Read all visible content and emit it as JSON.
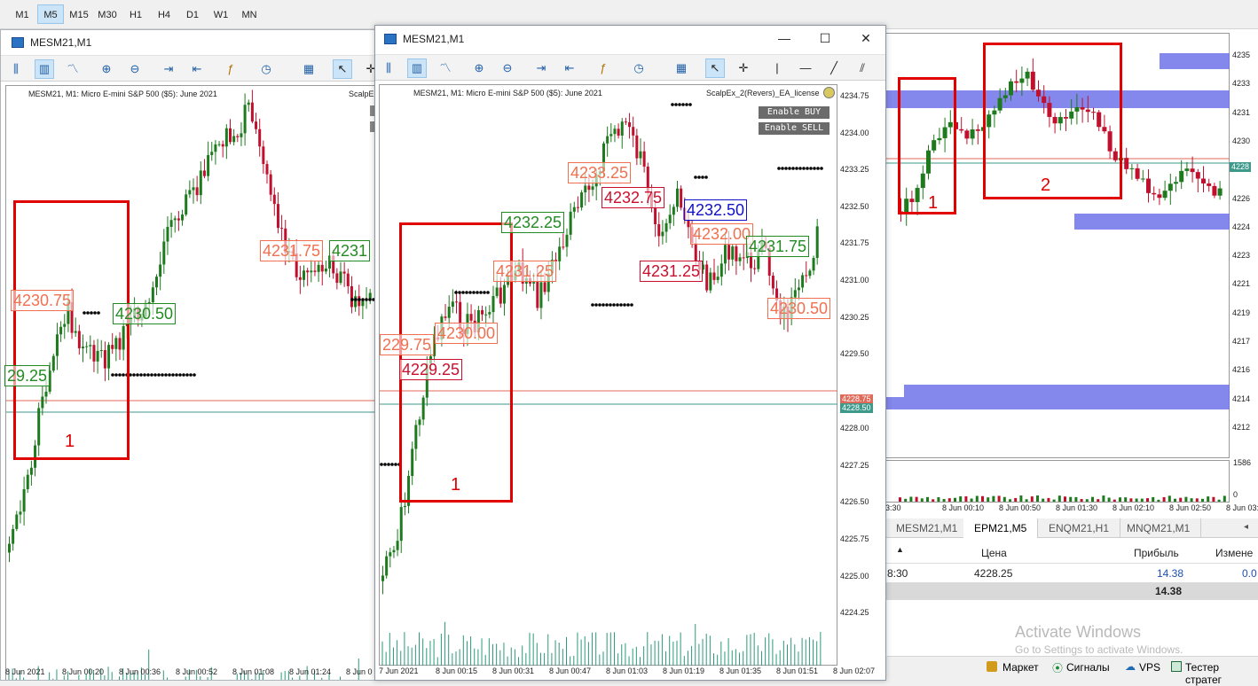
{
  "timeframes": [
    "M1",
    "M5",
    "M15",
    "M30",
    "H1",
    "H4",
    "D1",
    "W1",
    "MN"
  ],
  "timeframe_active": "M5",
  "left_window": {
    "title": "MESM21,M1",
    "chart_info": "MESM21, M1:  Micro E-mini S&P 500 ($5): June 2021",
    "ea_label": "ScalpE",
    "box_label": "1",
    "levels": [
      {
        "text": "4230.75",
        "color": "#f07050"
      },
      {
        "text": "4230.50",
        "color": "#228b22"
      },
      {
        "text": "29.25",
        "color": "#228b22"
      },
      {
        "text": "4231.75",
        "color": "#f07050"
      },
      {
        "text": "4231",
        "color": "#228b22"
      }
    ],
    "time_ticks": [
      "8 Jun 2021",
      "8 Jun 00:20",
      "8 Jun 00:36",
      "8 Jun 00:52",
      "8 Jun 01:08",
      "8 Jun 01:24",
      "8 Jun 0"
    ]
  },
  "middle_window": {
    "title": "MESM21,M1",
    "minimize_glyph": "—",
    "maximize_glyph": "☐",
    "close_glyph": "✕",
    "chart_info": "MESM21, M1:  Micro E-mini S&P 500 ($5): June 2021",
    "ea_label": "ScalpEx_2(Revers)_EA_license",
    "enable_buy": "Enable BUY",
    "enable_sell": "Enable SELL",
    "box_label": "1",
    "levels": [
      {
        "text": "4233.25",
        "color": "#f07050"
      },
      {
        "text": "4232.75",
        "color": "#c8102e"
      },
      {
        "text": "4232.25",
        "color": "#228b22"
      },
      {
        "text": "4232.50",
        "color": "#1010c8"
      },
      {
        "text": "4232.00",
        "color": "#f07050"
      },
      {
        "text": "4231.75",
        "color": "#228b22"
      },
      {
        "text": "4231.25",
        "color": "#f07050"
      },
      {
        "text": "4231.25",
        "color": "#c8102e"
      },
      {
        "text": "4230.50",
        "color": "#f07050"
      },
      {
        "text": "4230.00",
        "color": "#f07050"
      },
      {
        "text": "229.75",
        "color": "#f07050"
      },
      {
        "text": "4229.25",
        "color": "#c8102e"
      }
    ],
    "price_ticks": [
      "4234.75",
      "4234.00",
      "4233.25",
      "4232.50",
      "4231.75",
      "4231.00",
      "4230.25",
      "4229.50",
      "4228.75",
      "4228.50",
      "4228.00",
      "4227.25",
      "4226.50",
      "4225.75",
      "4225.00",
      "4224.25"
    ],
    "bid_tag": "4228.75",
    "ask_tag": "4228.50",
    "time_ticks": [
      "7 Jun 2021",
      "8 Jun 00:15",
      "8 Jun 00:31",
      "8 Jun 00:47",
      "8 Jun 01:03",
      "8 Jun 01:19",
      "8 Jun 01:35",
      "8 Jun 01:51",
      "8 Jun 02:07"
    ]
  },
  "right_window": {
    "box1_label": "1",
    "box2_label": "2",
    "price_ticks": [
      "4235",
      "4233",
      "4231",
      "4230",
      "4228",
      "4226",
      "4224",
      "4223",
      "4221",
      "4219",
      "4217",
      "4216",
      "4214",
      "4212"
    ],
    "cur_tag": "4228",
    "volume_max": "1586",
    "volume_min": "0",
    "time_ticks": [
      "3:30",
      "8 Jun 00:10",
      "8 Jun 00:50",
      "8 Jun 01:30",
      "8 Jun 02:10",
      "8 Jun 02:50",
      "8 Jun 03:30"
    ],
    "tabs": [
      "MESM21,M1",
      "EPM21,M5",
      "ENQM21,H1",
      "MNQM21,M1"
    ],
    "tab_active": 1,
    "table": {
      "headers": [
        "",
        "Цена",
        "Прибыль",
        "Измене"
      ],
      "row": [
        "8:30",
        "4228.25",
        "14.38",
        "0.0"
      ],
      "total": "14.38"
    },
    "watermark_title": "Activate Windows",
    "watermark_sub": "Go to Settings to activate Windows."
  },
  "status_bar": [
    "Маркет",
    "Сигналы",
    "VPS",
    "Тестер стратег"
  ],
  "colors": {
    "red_box": "#e00000",
    "bull": "#1d7a1d",
    "bear": "#c0102e",
    "band": "#6f72e8"
  }
}
